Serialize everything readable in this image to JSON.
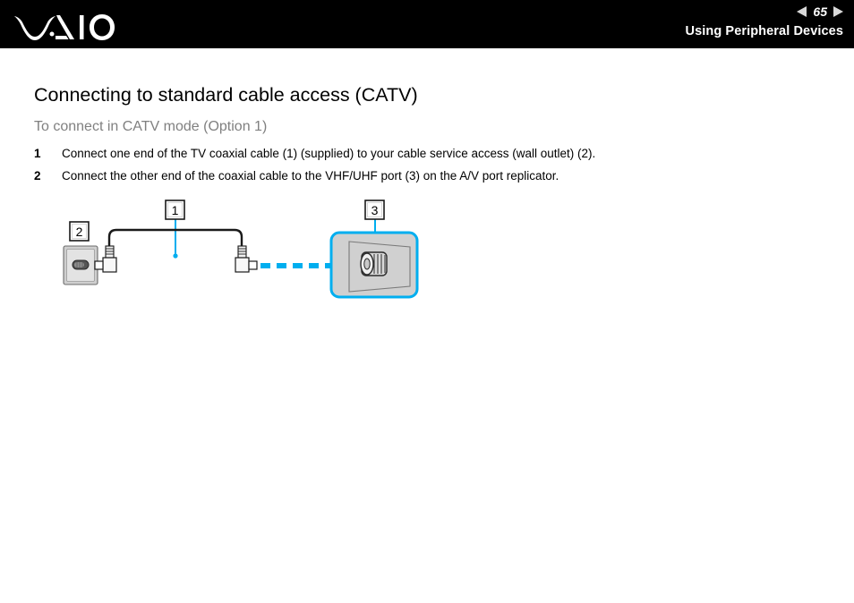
{
  "header": {
    "logo_name": "VAIO",
    "page_number": "65",
    "prev_icon": "triangle-left-icon",
    "next_icon": "triangle-right-icon",
    "section_title": "Using Peripheral Devices"
  },
  "main": {
    "heading": "Connecting to standard cable access (CATV)",
    "subheading": "To connect in CATV mode (Option 1)",
    "steps": [
      {
        "number": "1",
        "text": "Connect one end of the TV coaxial cable (1) (supplied) to your cable service access (wall outlet) (2)."
      },
      {
        "number": "2",
        "text": "Connect the other end of the coaxial cable to the VHF/UHF port (3) on the A/V port replicator."
      }
    ]
  },
  "diagram": {
    "name": "catv-connection-diagram",
    "callouts": [
      {
        "id": "callout-1",
        "label": "1",
        "refers_to": "tv-coaxial-cable"
      },
      {
        "id": "callout-2",
        "label": "2",
        "refers_to": "cable-service-access-wall-outlet"
      },
      {
        "id": "callout-3",
        "label": "3",
        "refers_to": "vhf-uhf-port"
      }
    ],
    "parts": {
      "wall_outlet": "wall-outlet-plate",
      "coaxial_cable": "tv-coaxial-cable",
      "left_connector": "coax-connector-left",
      "right_connector": "coax-connector-right",
      "port_replicator": "av-port-replicator",
      "vhf_uhf_port": "vhf-uhf-port",
      "insertion_arrow": "dashed-insertion-arrow"
    },
    "colors": {
      "accent": "#00AEEF",
      "line": "#1a1a1a",
      "device_fill": "#d4d4d4",
      "plate_fill": "#e0e0e0",
      "header_bg": "#000000",
      "subheading": "#808080"
    }
  }
}
